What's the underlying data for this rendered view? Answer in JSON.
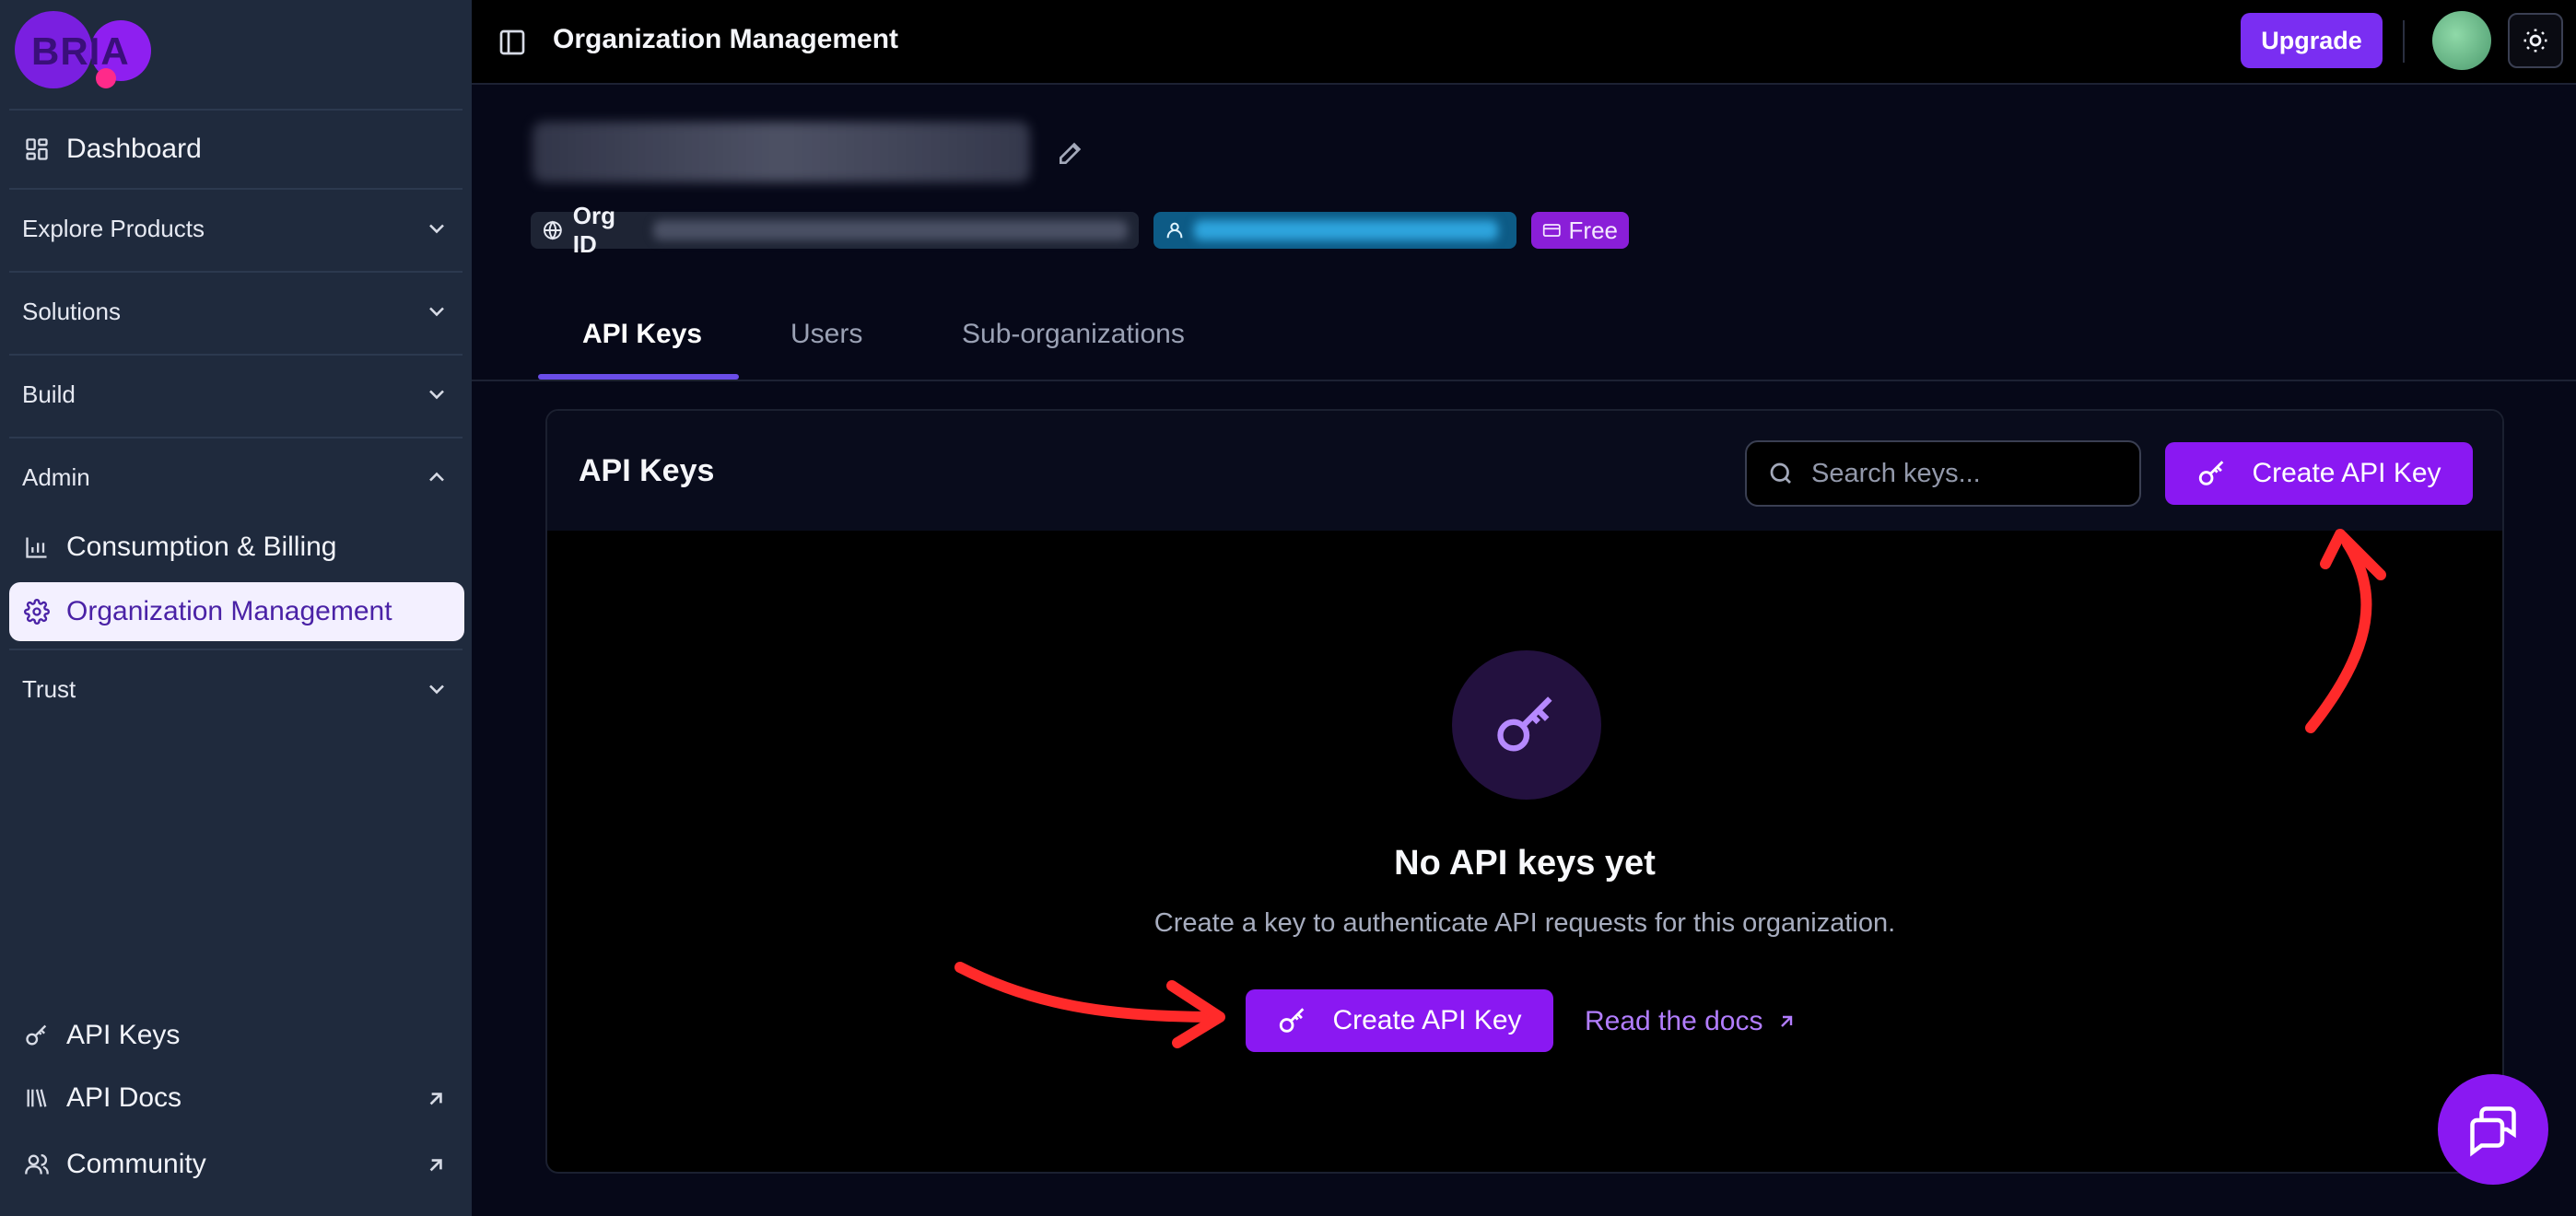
{
  "sidebar": {
    "logo_text": "BRIA",
    "dashboard": "Dashboard",
    "sections": {
      "explore": "Explore Products",
      "solutions": "Solutions",
      "build": "Build",
      "admin": "Admin",
      "trust": "Trust"
    },
    "admin_items": {
      "billing": "Consumption & Billing",
      "org_mgmt": "Organization Management"
    },
    "bottom": {
      "api_keys": "API Keys",
      "api_docs": "API Docs",
      "community": "Community"
    }
  },
  "topbar": {
    "title": "Organization Management",
    "upgrade": "Upgrade"
  },
  "org": {
    "org_id_label": "Org ID",
    "plan": "Free"
  },
  "tabs": [
    "API Keys",
    "Users",
    "Sub-organizations"
  ],
  "card": {
    "title": "API Keys",
    "search_placeholder": "Search keys...",
    "create_button": "Create API Key",
    "empty_title": "No API keys yet",
    "empty_subtitle": "Create a key to authenticate API requests for this organization.",
    "docs_link": "Read the docs"
  },
  "colors": {
    "accent": "#8a18f2",
    "sidebar_bg": "#1f2a3d",
    "annotation_arrow": "#ff2a2a"
  }
}
